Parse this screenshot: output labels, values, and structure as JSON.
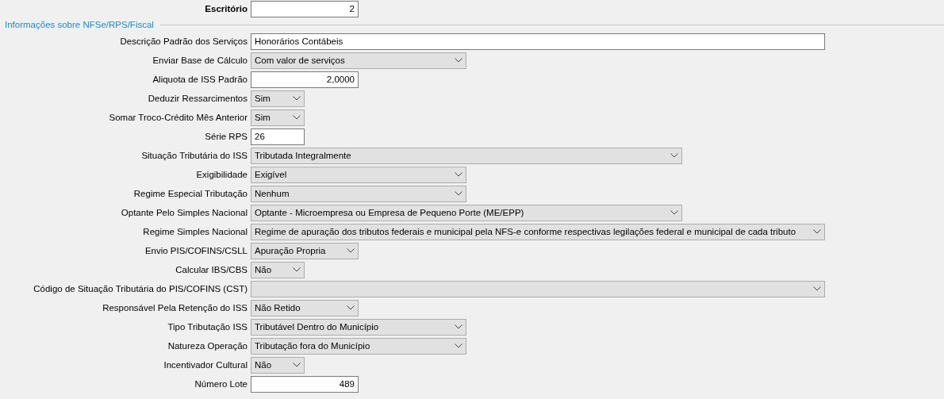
{
  "office": {
    "label": "Escritório",
    "value": "2"
  },
  "section": {
    "title": "Informações sobre NFSe/RPS/Fiscal"
  },
  "fields": [
    {
      "label": "Descrição Padrão dos Serviços",
      "kind": "text",
      "value": "Honorários Contábeis"
    },
    {
      "label": "Enviar Base de Cálculo",
      "kind": "select",
      "value": "Com valor de serviços"
    },
    {
      "label": "Aliquota de ISS Padrão",
      "kind": "number",
      "value": "2,0000"
    },
    {
      "label": "Deduzir Ressarcimentos",
      "kind": "select",
      "value": "Sim"
    },
    {
      "label": "Somar Troco-Crédito Mês Anterior",
      "kind": "select",
      "value": "Sim"
    },
    {
      "label": "Série RPS",
      "kind": "text",
      "value": "26"
    },
    {
      "label": "Situação Tributária do ISS",
      "kind": "select",
      "value": "Tributada Integralmente"
    },
    {
      "label": "Exigibilidade",
      "kind": "select",
      "value": "Exigível"
    },
    {
      "label": "Regime Especial Tributação",
      "kind": "select",
      "value": "Nenhum"
    },
    {
      "label": "Optante Pelo Simples Nacional",
      "kind": "select",
      "value": "Optante - Microempresa ou Empresa de Pequeno Porte (ME/EPP)"
    },
    {
      "label": "Regime Simples Nacional",
      "kind": "select",
      "value": "Regime de apuração dos tributos federais e municipal pela NFS-e conforme respectivas legilações federal e municipal de cada tributo"
    },
    {
      "label": "Envio PIS/COFINS/CSLL",
      "kind": "select",
      "value": "Apuração Propria"
    },
    {
      "label": "Calcular IBS/CBS",
      "kind": "select",
      "value": "Não"
    },
    {
      "label": "Código de Situação Tributária do PIS/COFINS (CST)",
      "kind": "select"
    },
    {
      "label": "Responsável Pela Retenção do ISS",
      "kind": "select",
      "value": "Não Retido"
    },
    {
      "label": "Tipo Tributação ISS",
      "kind": "select",
      "value": "Tributável Dentro do Município"
    },
    {
      "label": "Natureza Operação",
      "kind": "select",
      "value": "Tributação fora do Município"
    },
    {
      "label": "Incentivador Cultural",
      "kind": "select",
      "value": "Não"
    },
    {
      "label": "Número Lote",
      "kind": "number",
      "value": "489"
    }
  ]
}
